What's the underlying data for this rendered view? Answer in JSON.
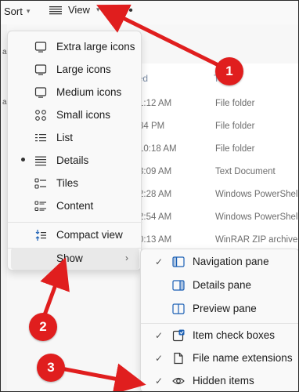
{
  "toolbar": {
    "sort_label": "Sort",
    "view_label": "View",
    "more_label": "•••"
  },
  "left_strip": [
    "a",
    "a",
    "u"
  ],
  "file_list": {
    "header_modified": "ied",
    "header_type": "T",
    "rows": [
      {
        "time": "1:12 AM",
        "type": "File folder"
      },
      {
        "time": "34 PM",
        "type": "File folder"
      },
      {
        "time": "10:18 AM",
        "type": "File folder"
      },
      {
        "time": "3:09 AM",
        "type": "Text Document"
      },
      {
        "time": "2:28 AM",
        "type": "Windows PowerShell"
      },
      {
        "time": "2:54 AM",
        "type": "Windows PowerShell"
      },
      {
        "time": "0:13 AM",
        "type": "WinRAR ZIP archive"
      }
    ]
  },
  "view_menu": {
    "items": [
      {
        "label": "Extra large icons",
        "icon": "monitor-icon"
      },
      {
        "label": "Large icons",
        "icon": "monitor-icon"
      },
      {
        "label": "Medium icons",
        "icon": "monitor-icon"
      },
      {
        "label": "Small icons",
        "icon": "small-icons-grid-icon"
      },
      {
        "label": "List",
        "icon": "list-icon"
      },
      {
        "label": "Details",
        "icon": "details-icon",
        "selected": true
      },
      {
        "label": "Tiles",
        "icon": "tiles-icon"
      },
      {
        "label": "Content",
        "icon": "content-icon"
      },
      {
        "label": "Compact view",
        "icon": "compact-view-icon"
      },
      {
        "label": "Show",
        "icon": "chevron-right-icon"
      }
    ]
  },
  "show_submenu": {
    "items": [
      {
        "label": "Navigation pane",
        "checked": true,
        "icon": "navigation-pane-icon"
      },
      {
        "label": "Details pane",
        "checked": false,
        "icon": "details-pane-icon"
      },
      {
        "label": "Preview pane",
        "checked": false,
        "icon": "preview-pane-icon"
      },
      {
        "label": "Item check boxes",
        "checked": true,
        "icon": "checkbox-icon"
      },
      {
        "label": "File name extensions",
        "checked": true,
        "icon": "file-icon"
      },
      {
        "label": "Hidden items",
        "checked": true,
        "icon": "eye-icon"
      }
    ]
  },
  "annotations": {
    "badge1": "1",
    "badge2": "2",
    "badge3": "3",
    "color": "#e01e1e"
  },
  "glyphs": {
    "check": "✓",
    "chevron_right": "›",
    "chevron_down": "⌄"
  }
}
